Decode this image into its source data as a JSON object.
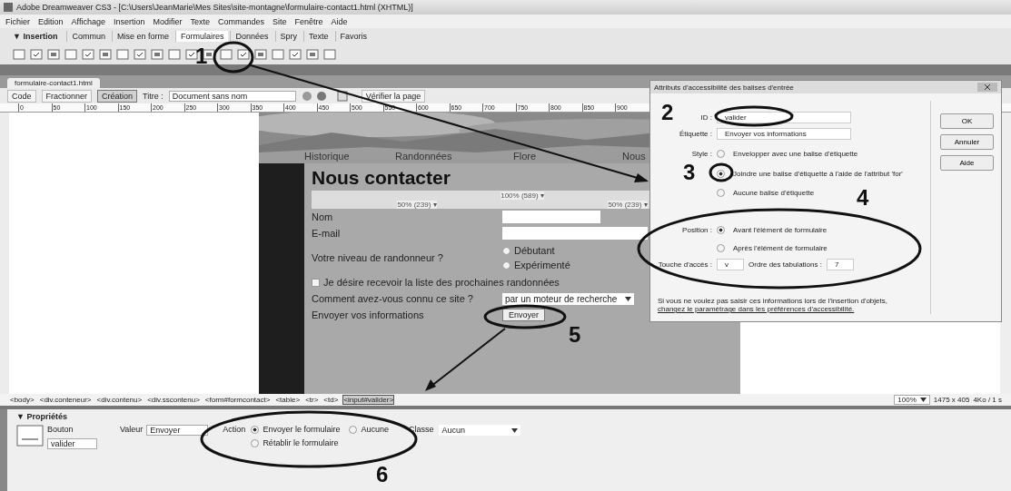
{
  "window": {
    "title": "Adobe Dreamweaver CS3 - [C:\\Users\\JeanMarie\\Mes Sites\\site-montagne\\formulaire-contact1.html (XHTML)]"
  },
  "menu": [
    "Fichier",
    "Edition",
    "Affichage",
    "Insertion",
    "Modifier",
    "Texte",
    "Commandes",
    "Site",
    "Fenêtre",
    "Aide"
  ],
  "insert_panel": {
    "title": "▼ Insertion",
    "tabs": [
      {
        "label": "Commun",
        "selected": false
      },
      {
        "label": "Mise en forme",
        "selected": false
      },
      {
        "label": "Formulaires",
        "selected": true
      },
      {
        "label": "Données",
        "selected": false
      },
      {
        "label": "Spry",
        "selected": false
      },
      {
        "label": "Texte",
        "selected": false
      },
      {
        "label": "Favoris",
        "selected": false
      }
    ]
  },
  "document": {
    "tab": "formulaire-contact1.html",
    "views": [
      {
        "label": "Code",
        "selected": false
      },
      {
        "label": "Fractionner",
        "selected": false
      },
      {
        "label": "Création",
        "selected": true
      }
    ],
    "title_label": "Titre :",
    "title_value": "Document sans nom",
    "check_page": "Vérifier la page",
    "ruler": [
      "0",
      "50",
      "100",
      "150",
      "200",
      "250",
      "300",
      "350",
      "400",
      "450",
      "500",
      "550",
      "600",
      "650",
      "700",
      "750",
      "800",
      "850",
      "900"
    ]
  },
  "page": {
    "nav": [
      "Historique",
      "Randonnées",
      "Flore",
      "Nous"
    ],
    "heading": "Nous contacter",
    "width_marks": [
      "100% (589) ▾",
      "50% (239) ▾",
      "50% (239) ▾"
    ],
    "rows": [
      {
        "kind": "text",
        "label": "Nom"
      },
      {
        "kind": "text",
        "label": "E-mail"
      },
      {
        "kind": "radio",
        "label": "Votre niveau de randonneur ?",
        "options": [
          {
            "label": "Débutant",
            "selected": false
          },
          {
            "label": "Expérimenté",
            "selected": false
          }
        ]
      },
      {
        "kind": "checkbox",
        "label": "Je désire recevoir la liste des prochaines randonnées",
        "checked": false
      },
      {
        "kind": "select",
        "label": "Comment avez-vous connu ce site ?",
        "value": "par un moteur de recherche"
      },
      {
        "kind": "button",
        "label": "Envoyer vos informations",
        "value": "Envoyer"
      }
    ]
  },
  "dialog": {
    "title": "Attributs d'accessibilité des balises d'entrée",
    "id_label": "ID :",
    "id_value": "valider",
    "label_label": "Étiquette :",
    "label_value": "Envoyer vos informations",
    "style_label": "Style :",
    "style_options": [
      {
        "label": "Envelopper avec une balise d'étiquette",
        "selected": false
      },
      {
        "label": "Joindre une balise d'étiquette à l'aide de l'attribut 'for'",
        "selected": true
      },
      {
        "label": "Aucune balise d'étiquette",
        "selected": false
      }
    ],
    "position_label": "Position :",
    "position_options": [
      {
        "label": "Avant l'élément de formulaire",
        "selected": true
      },
      {
        "label": "Après l'élément de formulaire",
        "selected": false
      }
    ],
    "key_label": "Touche d'accès :",
    "key_value": "v",
    "tab_label": "Ordre des tabulations :",
    "tab_value": "7",
    "note": "Si vous ne voulez pas saisir ces informations lors de l'insertion d'objets,",
    "link": "changez le paramétrage dans les préférences d'accessibilité.",
    "buttons": [
      "OK",
      "Annuler",
      "Aide"
    ]
  },
  "tag_bar": {
    "tags": [
      {
        "label": "<body>",
        "selected": false
      },
      {
        "label": "<div.conteneur>",
        "selected": false
      },
      {
        "label": "<div.contenu>",
        "selected": false
      },
      {
        "label": "<div.sscontenu>",
        "selected": false
      },
      {
        "label": "<form#formcontact>",
        "selected": false
      },
      {
        "label": "<table>",
        "selected": false
      },
      {
        "label": "<tr>",
        "selected": false
      },
      {
        "label": "<td>",
        "selected": false
      },
      {
        "label": "<input#valider>",
        "selected": true
      }
    ],
    "zoom": "100%",
    "size": "1475 x 405",
    "speed": "4Ko / 1 s"
  },
  "properties": {
    "title": "▼ Propriétés",
    "type": "Bouton",
    "name": "valider",
    "value_label": "Valeur",
    "value": "Envoyer",
    "action_label": "Action",
    "actions": [
      {
        "label": "Envoyer le formulaire",
        "selected": true
      },
      {
        "label": "Aucune",
        "selected": false
      },
      {
        "label": "Rétablir le formulaire",
        "selected": false
      }
    ],
    "class_label": "Classe",
    "class_value": "Aucun"
  },
  "annotations": [
    "1",
    "2",
    "3",
    "4",
    "5",
    "6"
  ]
}
